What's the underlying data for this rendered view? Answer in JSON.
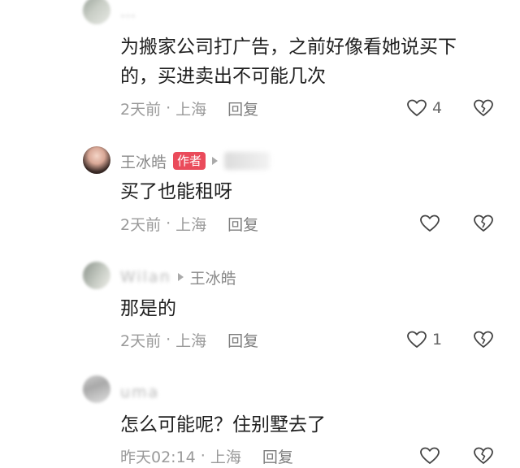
{
  "comments": [
    {
      "username": "…",
      "text_lines": [
        "为搬家公司打广告，之前好像看她说买下",
        "的，买进卖出不可能几次"
      ],
      "time": "2天前",
      "location": "上海",
      "reply_label": "回复",
      "likes": "4"
    },
    {
      "username": "王冰皓",
      "tag": "作者",
      "text_lines": [
        "买了也能租呀"
      ],
      "time": "2天前",
      "location": "上海",
      "reply_label": "回复",
      "likes": ""
    },
    {
      "username": "Wilan",
      "reply_to": "王冰皓",
      "text_lines": [
        "那是的"
      ],
      "time": "2天前",
      "location": "上海",
      "reply_label": "回复",
      "likes": "1"
    },
    {
      "username": "uma",
      "text_lines": [
        "怎么可能呢？住别墅去了"
      ],
      "time": "昨天02:14",
      "location": "上海",
      "reply_label": "回复",
      "likes": ""
    }
  ],
  "meta_separator": "·",
  "colors": {
    "author_tag": "#ea4b5b",
    "meta_text": "#9a9a9a",
    "body_text": "#1f1f1f"
  },
  "icons": {
    "like": "heart-outline-icon",
    "dislike": "broken-heart-icon"
  }
}
